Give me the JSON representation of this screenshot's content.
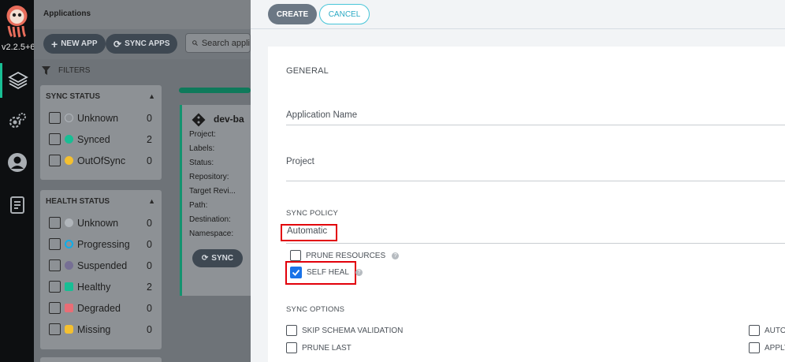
{
  "rail": {
    "version": "v2.2.5+6",
    "nav_items": [
      "applications-icon",
      "settings-icon",
      "user-info-icon",
      "docs-icon"
    ]
  },
  "background_page": {
    "title": "Applications",
    "toolbar": {
      "new_app": "NEW APP",
      "sync_apps": "SYNC APPS",
      "search_placeholder": "Search appli"
    },
    "filters_label": "FILTERS",
    "sync_status": {
      "title": "SYNC STATUS",
      "items": [
        {
          "label": "Unknown",
          "count": "0",
          "color": "#b0b5ba"
        },
        {
          "label": "Synced",
          "count": "2",
          "color": "#18be94"
        },
        {
          "label": "OutOfSync",
          "count": "0",
          "color": "#f4c030"
        }
      ]
    },
    "health_status": {
      "title": "HEALTH STATUS",
      "items": [
        {
          "label": "Unknown",
          "count": "0",
          "color": "#b0b5ba"
        },
        {
          "label": "Progressing",
          "count": "0",
          "color": "#0dadea"
        },
        {
          "label": "Suspended",
          "count": "0",
          "color": "#766f94"
        },
        {
          "label": "Healthy",
          "count": "2",
          "color": "#18be94"
        },
        {
          "label": "Degraded",
          "count": "0",
          "color": "#e96d76"
        },
        {
          "label": "Missing",
          "count": "0",
          "color": "#f4c030"
        }
      ]
    },
    "app_card": {
      "name": "dev-ba",
      "fields": [
        "Project:",
        "Labels:",
        "Status:",
        "Repository:",
        "Target Revi...",
        "Path:",
        "Destination:",
        "Namespace:"
      ],
      "sync_button": "SYNC"
    }
  },
  "sheet": {
    "create_button": "CREATE",
    "cancel_button": "CANCEL",
    "general_title": "GENERAL",
    "application_name_label": "Application Name",
    "project_label": "Project",
    "sync_policy_title": "SYNC POLICY",
    "sync_policy_value": "Automatic",
    "prune_resources": "PRUNE RESOURCES",
    "self_heal": "SELF HEAL",
    "self_heal_checked": true,
    "sync_options_title": "SYNC OPTIONS",
    "skip_schema_validation": "SKIP SCHEMA VALIDATION",
    "prune_last": "PRUNE LAST",
    "auto_create_partial": "AUTO-",
    "apply_partial": "APPLY"
  }
}
